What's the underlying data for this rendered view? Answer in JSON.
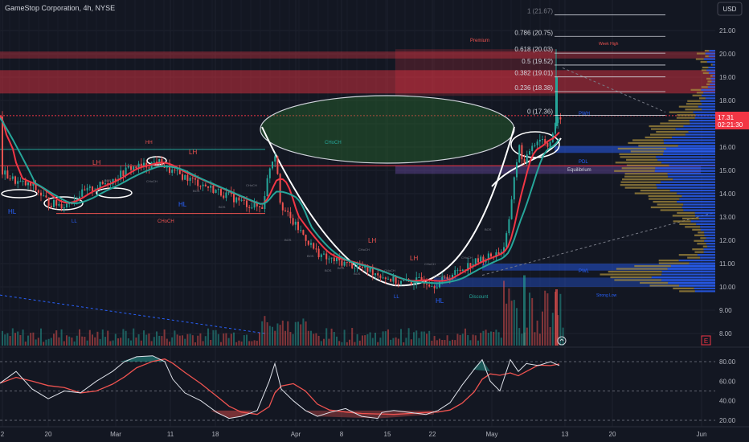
{
  "header": {
    "symbol_title": "GameStop Corporation, 4h, NYSE",
    "currency_button": "USD"
  },
  "price_scale": {
    "ticks": [
      "21.00",
      "20.00",
      "19.00",
      "18.00",
      "17.00",
      "16.00",
      "15.00",
      "14.00",
      "13.00",
      "12.00",
      "11.00",
      "10.00",
      "9.00",
      "8.00"
    ],
    "current_price": "17.31",
    "countdown": "02:21:30"
  },
  "oscillator_scale": {
    "ticks": [
      "80.00",
      "60.00",
      "40.00",
      "20.00"
    ]
  },
  "time_axis": {
    "labels": [
      "2",
      "20",
      "Mar",
      "11",
      "18",
      "Apr",
      "8",
      "15",
      "22",
      "May",
      "13",
      "20",
      "Jun"
    ]
  },
  "fib_levels": [
    {
      "label": "1 (21.67)",
      "price": 21.67
    },
    {
      "label": "0.786 (20.75)",
      "price": 20.75
    },
    {
      "label": "0.618 (20.03)",
      "price": 20.03
    },
    {
      "label": "0.5 (19.52)",
      "price": 19.52
    },
    {
      "label": "0.382 (19.01)",
      "price": 19.01
    },
    {
      "label": "0.236 (18.38)",
      "price": 18.38
    },
    {
      "label": "0 (17.36)",
      "price": 17.36
    }
  ],
  "annotations": {
    "premium": "Premium",
    "week_high": "Week High",
    "equilibrium": "Equilibrium",
    "discount": "Discount",
    "strong_low": "Strong Low",
    "pwh": "PWH",
    "pdl": "PDL",
    "pwl": "PWL",
    "choch_top": "CHoCH",
    "choch_left": "CHoCH",
    "lh1": "LH",
    "hh": "HH",
    "lh2": "LH",
    "hl1": "HL",
    "ll1": "LL",
    "hl2": "HL",
    "lh3": "LH",
    "lh4": "LH",
    "ll2": "LL",
    "hl3": "HL",
    "bos_labels": [
      "BOS",
      "BOS",
      "BOS",
      "BOS",
      "BOS",
      "BOS",
      "BOS",
      "BOS",
      "BOS",
      "BOS"
    ],
    "choch_small": [
      "CHoCH",
      "CHoCH",
      "CHoCH",
      "CHoCH",
      "CHoCH",
      "CHoCH",
      "CHoCH"
    ],
    "event_e": "E"
  },
  "colors": {
    "background": "#131722",
    "up": "#26a69a",
    "down": "#ef5350",
    "ema": "#26a69a",
    "wma": "#f23645",
    "zone_red": "#f23645",
    "zone_blue": "#2962ff",
    "cup_fill": "#2e7d32",
    "volume_profile_up": "#2962ff",
    "volume_profile_down": "#a68b3c",
    "price_badge": "#f23645"
  },
  "chart_data": {
    "type": "candlestick",
    "title": "GameStop Corporation, 4h, NYSE",
    "price_range": [
      7.5,
      22.2
    ],
    "oscillator_range": [
      15,
      90
    ],
    "close_path": [
      {
        "date": "Feb 12",
        "close": 14.8
      },
      {
        "date": "Feb 16",
        "close": 14.2
      },
      {
        "date": "Feb 20",
        "close": 13.6
      },
      {
        "date": "Feb 23",
        "close": 14.0
      },
      {
        "date": "Feb 27",
        "close": 14.9
      },
      {
        "date": "Mar 1",
        "close": 15.2
      },
      {
        "date": "Mar 5",
        "close": 15.3
      },
      {
        "date": "Mar 8",
        "close": 14.9
      },
      {
        "date": "Mar 12",
        "close": 14.3
      },
      {
        "date": "Mar 15",
        "close": 14.0
      },
      {
        "date": "Mar 19",
        "close": 13.6
      },
      {
        "date": "Mar 22",
        "close": 13.3
      },
      {
        "date": "Mar 25",
        "close": 15.8
      },
      {
        "date": "Mar 27",
        "close": 13.4
      },
      {
        "date": "Apr 1",
        "close": 12.2
      },
      {
        "date": "Apr 4",
        "close": 11.3
      },
      {
        "date": "Apr 8",
        "close": 10.9
      },
      {
        "date": "Apr 11",
        "close": 10.8
      },
      {
        "date": "Apr 16",
        "close": 10.1
      },
      {
        "date": "Apr 19",
        "close": 10.2
      },
      {
        "date": "Apr 22",
        "close": 10.0
      },
      {
        "date": "Apr 25",
        "close": 10.6
      },
      {
        "date": "Apr 29",
        "close": 11.0
      },
      {
        "date": "May 1",
        "close": 11.2
      },
      {
        "date": "May 3",
        "close": 14.5
      },
      {
        "date": "May 6",
        "close": 16.5
      },
      {
        "date": "May 8",
        "close": 15.9
      },
      {
        "date": "May 10",
        "close": 16.3
      },
      {
        "date": "May 13",
        "close": 17.31
      }
    ],
    "zones": [
      {
        "name": "Premium",
        "from": 19.9,
        "to": 20.1
      },
      {
        "name": "Supply",
        "from": 18.3,
        "to": 19.3
      },
      {
        "name": "PDL",
        "from": 15.0,
        "to": 15.2
      },
      {
        "name": "PWL",
        "from": 10.7,
        "to": 11.0
      }
    ],
    "last_price": 17.31
  }
}
